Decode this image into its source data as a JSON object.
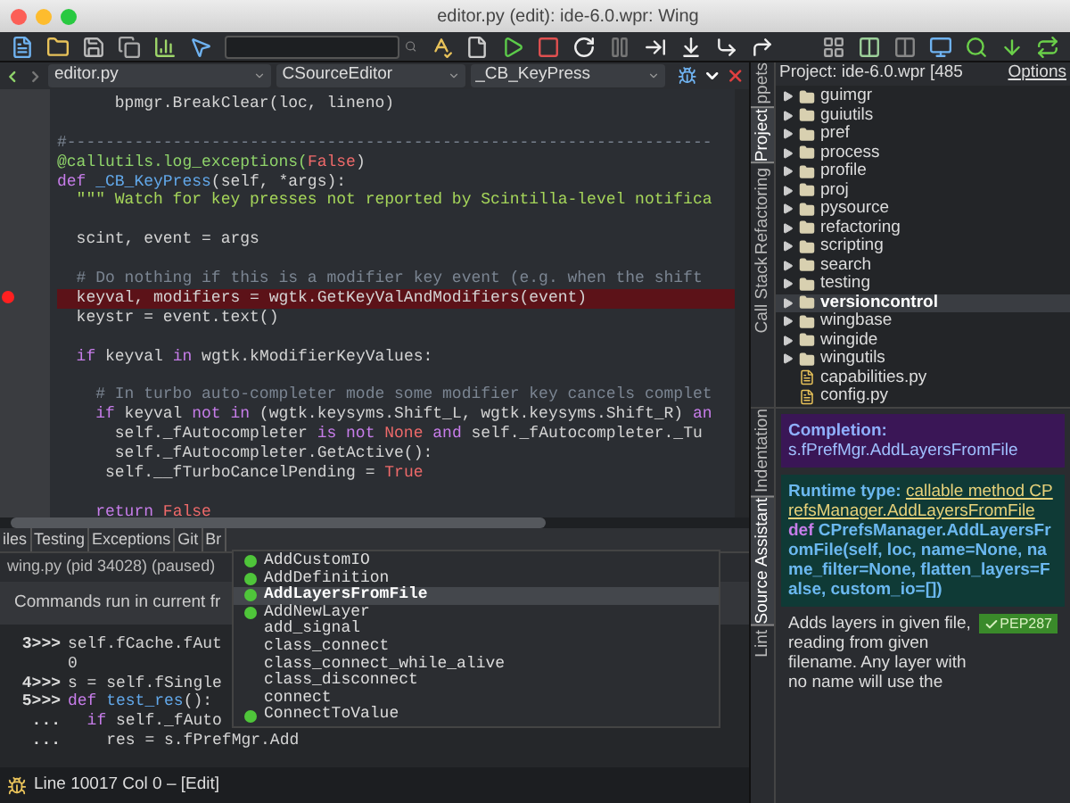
{
  "window": {
    "title": "editor.py (edit): ide-6.0.wpr: Wing"
  },
  "editor": {
    "selectors": [
      "editor.py",
      "CSourceEditor",
      "_CB_KeyPress"
    ],
    "lines": [
      {
        "breakpoint": false,
        "segs": [
          {
            "kind": "plain",
            "text": "      bpmgr.BreakClear(loc, lineno)"
          }
        ]
      },
      {
        "breakpoint": false
      },
      {
        "breakpoint": false,
        "segs": [
          {
            "kind": "comment",
            "text": "#-------------------------------------------------------------------"
          }
        ]
      },
      {
        "breakpoint": false,
        "segs": [
          {
            "kind": "decorator",
            "text": "@callutils.log_exceptions("
          },
          {
            "kind": "constant",
            "text": "False"
          },
          {
            "kind": "plain",
            "text": ")"
          }
        ]
      },
      {
        "breakpoint": false,
        "segs": [
          {
            "kind": "keyword",
            "text": "def"
          },
          {
            "kind": "name",
            "text": " _CB_KeyPress"
          },
          {
            "kind": "plain",
            "text": "(self, *args):"
          }
        ]
      },
      {
        "breakpoint": false,
        "segs": [
          {
            "kind": "string",
            "text": "  \"\"\" Watch for key presses not reported by Scintilla-level notifica"
          }
        ]
      },
      {
        "breakpoint": false
      },
      {
        "breakpoint": false,
        "segs": [
          {
            "kind": "plain",
            "text": "  scint, event = args"
          }
        ]
      },
      {
        "breakpoint": false
      },
      {
        "breakpoint": false,
        "segs": [
          {
            "kind": "comment",
            "text": "  # Do nothing if this is a modifier key event (e.g. when the shift"
          }
        ]
      },
      {
        "breakpoint": true,
        "segs": [
          {
            "kind": "plain",
            "text": "  keyval, modifiers = wgtk.GetKeyValAndModifiers(event)"
          }
        ]
      },
      {
        "breakpoint": false,
        "segs": [
          {
            "kind": "plain",
            "text": "  keystr = event.text()"
          }
        ]
      },
      {
        "breakpoint": false
      },
      {
        "breakpoint": false,
        "segs": [
          {
            "kind": "keyword",
            "text": "  if"
          },
          {
            "kind": "plain",
            "text": " keyval "
          },
          {
            "kind": "keyword",
            "text": "in"
          },
          {
            "kind": "plain",
            "text": " wgtk.kModifierKeyValues:"
          }
        ]
      },
      {
        "breakpoint": false
      },
      {
        "breakpoint": false,
        "segs": [
          {
            "kind": "comment",
            "text": "    # In turbo auto-completer mode some modifier key cancels complet"
          }
        ]
      },
      {
        "breakpoint": false,
        "segs": [
          {
            "kind": "keyword",
            "text": "    if"
          },
          {
            "kind": "plain",
            "text": " keyval "
          },
          {
            "kind": "keyword",
            "text": "not in"
          },
          {
            "kind": "plain",
            "text": " (wgtk.keysyms.Shift_L, wgtk.keysyms.Shift_R) "
          },
          {
            "kind": "keyword",
            "text": "an"
          }
        ]
      },
      {
        "breakpoint": false,
        "segs": [
          {
            "kind": "plain",
            "text": "      self._fAutocompleter "
          },
          {
            "kind": "keyword",
            "text": "is not"
          },
          {
            "kind": "constant",
            "text": " None"
          },
          {
            "kind": "keyword",
            "text": " and"
          },
          {
            "kind": "plain",
            "text": " self._fAutocompleter._Tu"
          }
        ]
      },
      {
        "breakpoint": false,
        "segs": [
          {
            "kind": "plain",
            "text": "      self._fAutocompleter.GetActive():"
          }
        ]
      },
      {
        "breakpoint": false,
        "segs": [
          {
            "kind": "plain",
            "text": "     self.__fTurboCancelPending = "
          },
          {
            "kind": "constant",
            "text": "True"
          }
        ]
      },
      {
        "breakpoint": false
      },
      {
        "breakpoint": false,
        "segs": [
          {
            "kind": "keyword",
            "text": "    return"
          },
          {
            "kind": "constant",
            "text": " False"
          }
        ]
      }
    ]
  },
  "bottom_panel": {
    "tabs": [
      {
        "label": "iles",
        "selected": false
      },
      {
        "label": "Testing",
        "selected": false
      },
      {
        "label": "Exceptions",
        "selected": false
      },
      {
        "label": "Git",
        "selected": false
      },
      {
        "label": "Br",
        "selected": false
      }
    ],
    "process": "wing.py (pid 34028) (paused)",
    "info": "Commands run in current fr",
    "shell": [
      {
        "prompt": "3>>>",
        "segs": [
          {
            "kind": "plain",
            "text": "self.fCache.fAut"
          }
        ]
      },
      {
        "segs": [
          {
            "kind": "plain",
            "text": "0"
          }
        ]
      },
      {
        "prompt": "4>>>",
        "segs": [
          {
            "kind": "plain",
            "text": "s = self.fSingle"
          }
        ]
      },
      {
        "prompt": "5>>>",
        "segs": [
          {
            "kind": "keyword",
            "text": "def"
          },
          {
            "kind": "name",
            "text": " test_res"
          },
          {
            "kind": "plain",
            "text": "():"
          }
        ]
      },
      {
        "prompt": "...",
        "segs": [
          {
            "kind": "keyword",
            "text": "  if"
          },
          {
            "kind": "plain",
            "text": " self._fAuto"
          }
        ]
      },
      {
        "prompt": "...",
        "segs": [
          {
            "kind": "plain",
            "text": "    res = s.fPrefMgr.Add"
          }
        ]
      }
    ],
    "completions": [
      {
        "label": "AddCustomIO",
        "runtime": true,
        "selected": false
      },
      {
        "label": "AddDefinition",
        "runtime": true,
        "selected": false
      },
      {
        "label": "AddLayersFromFile",
        "runtime": true,
        "selected": true
      },
      {
        "label": "AddNewLayer",
        "runtime": true,
        "selected": false
      },
      {
        "label": "add_signal",
        "runtime": false,
        "selected": false
      },
      {
        "label": "class_connect",
        "runtime": false,
        "selected": false
      },
      {
        "label": "class_connect_while_alive",
        "runtime": false,
        "selected": false
      },
      {
        "label": "class_disconnect",
        "runtime": false,
        "selected": false
      },
      {
        "label": "connect",
        "runtime": false,
        "selected": false
      },
      {
        "label": "ConnectToValue",
        "runtime": true,
        "selected": false
      }
    ]
  },
  "status_bar": {
    "text": "Line 10017 Col 0 – [Edit]"
  },
  "side_tabs_top": [
    {
      "label": "ppets",
      "selected": false
    },
    {
      "label": "Project",
      "selected": true
    },
    {
      "label": "Refactoring",
      "selected": false
    },
    {
      "label": "Call Stack",
      "selected": false
    }
  ],
  "project": {
    "title": "Project: ide-6.0.wpr [485",
    "options": "Options",
    "items": [
      {
        "label": "guimgr",
        "kind": "folder",
        "selected": false
      },
      {
        "label": "guiutils",
        "kind": "folder",
        "selected": false
      },
      {
        "label": "pref",
        "kind": "folder",
        "selected": false
      },
      {
        "label": "process",
        "kind": "folder",
        "selected": false
      },
      {
        "label": "profile",
        "kind": "folder",
        "selected": false
      },
      {
        "label": "proj",
        "kind": "folder",
        "selected": false
      },
      {
        "label": "pysource",
        "kind": "folder",
        "selected": false
      },
      {
        "label": "refactoring",
        "kind": "folder",
        "selected": false
      },
      {
        "label": "scripting",
        "kind": "folder",
        "selected": false
      },
      {
        "label": "search",
        "kind": "folder",
        "selected": false
      },
      {
        "label": "testing",
        "kind": "folder",
        "selected": false
      },
      {
        "label": "versioncontrol",
        "kind": "folder",
        "selected": true
      },
      {
        "label": "wingbase",
        "kind": "folder",
        "selected": false
      },
      {
        "label": "wingide",
        "kind": "folder",
        "selected": false
      },
      {
        "label": "wingutils",
        "kind": "folder",
        "selected": false
      },
      {
        "label": "capabilities.py",
        "kind": "file",
        "selected": false
      },
      {
        "label": "config.py",
        "kind": "file",
        "selected": false
      }
    ]
  },
  "side_tabs_bottom": [
    {
      "label": "Indentation",
      "selected": false
    },
    {
      "label": "Source Assistant",
      "selected": true
    },
    {
      "label": "Lint",
      "selected": false
    }
  ],
  "source_assistant": {
    "completion_label": "Completion:",
    "completion": "s.fPrefMgr.AddLayersFromFile",
    "runtime_label": "Runtime type:",
    "runtime_type": "callable method CPrefsManager.AddLayersFromFile",
    "def_keyword": "def",
    "signature": "CPrefsManager.AddLayersFromFile(self, loc, name=None, name_filter=None, flatten_layers=False, custom_io=[])",
    "doc": "Adds layers in given file, reading from given filename. Any layer with no name will use the",
    "badge": "PEP287"
  }
}
